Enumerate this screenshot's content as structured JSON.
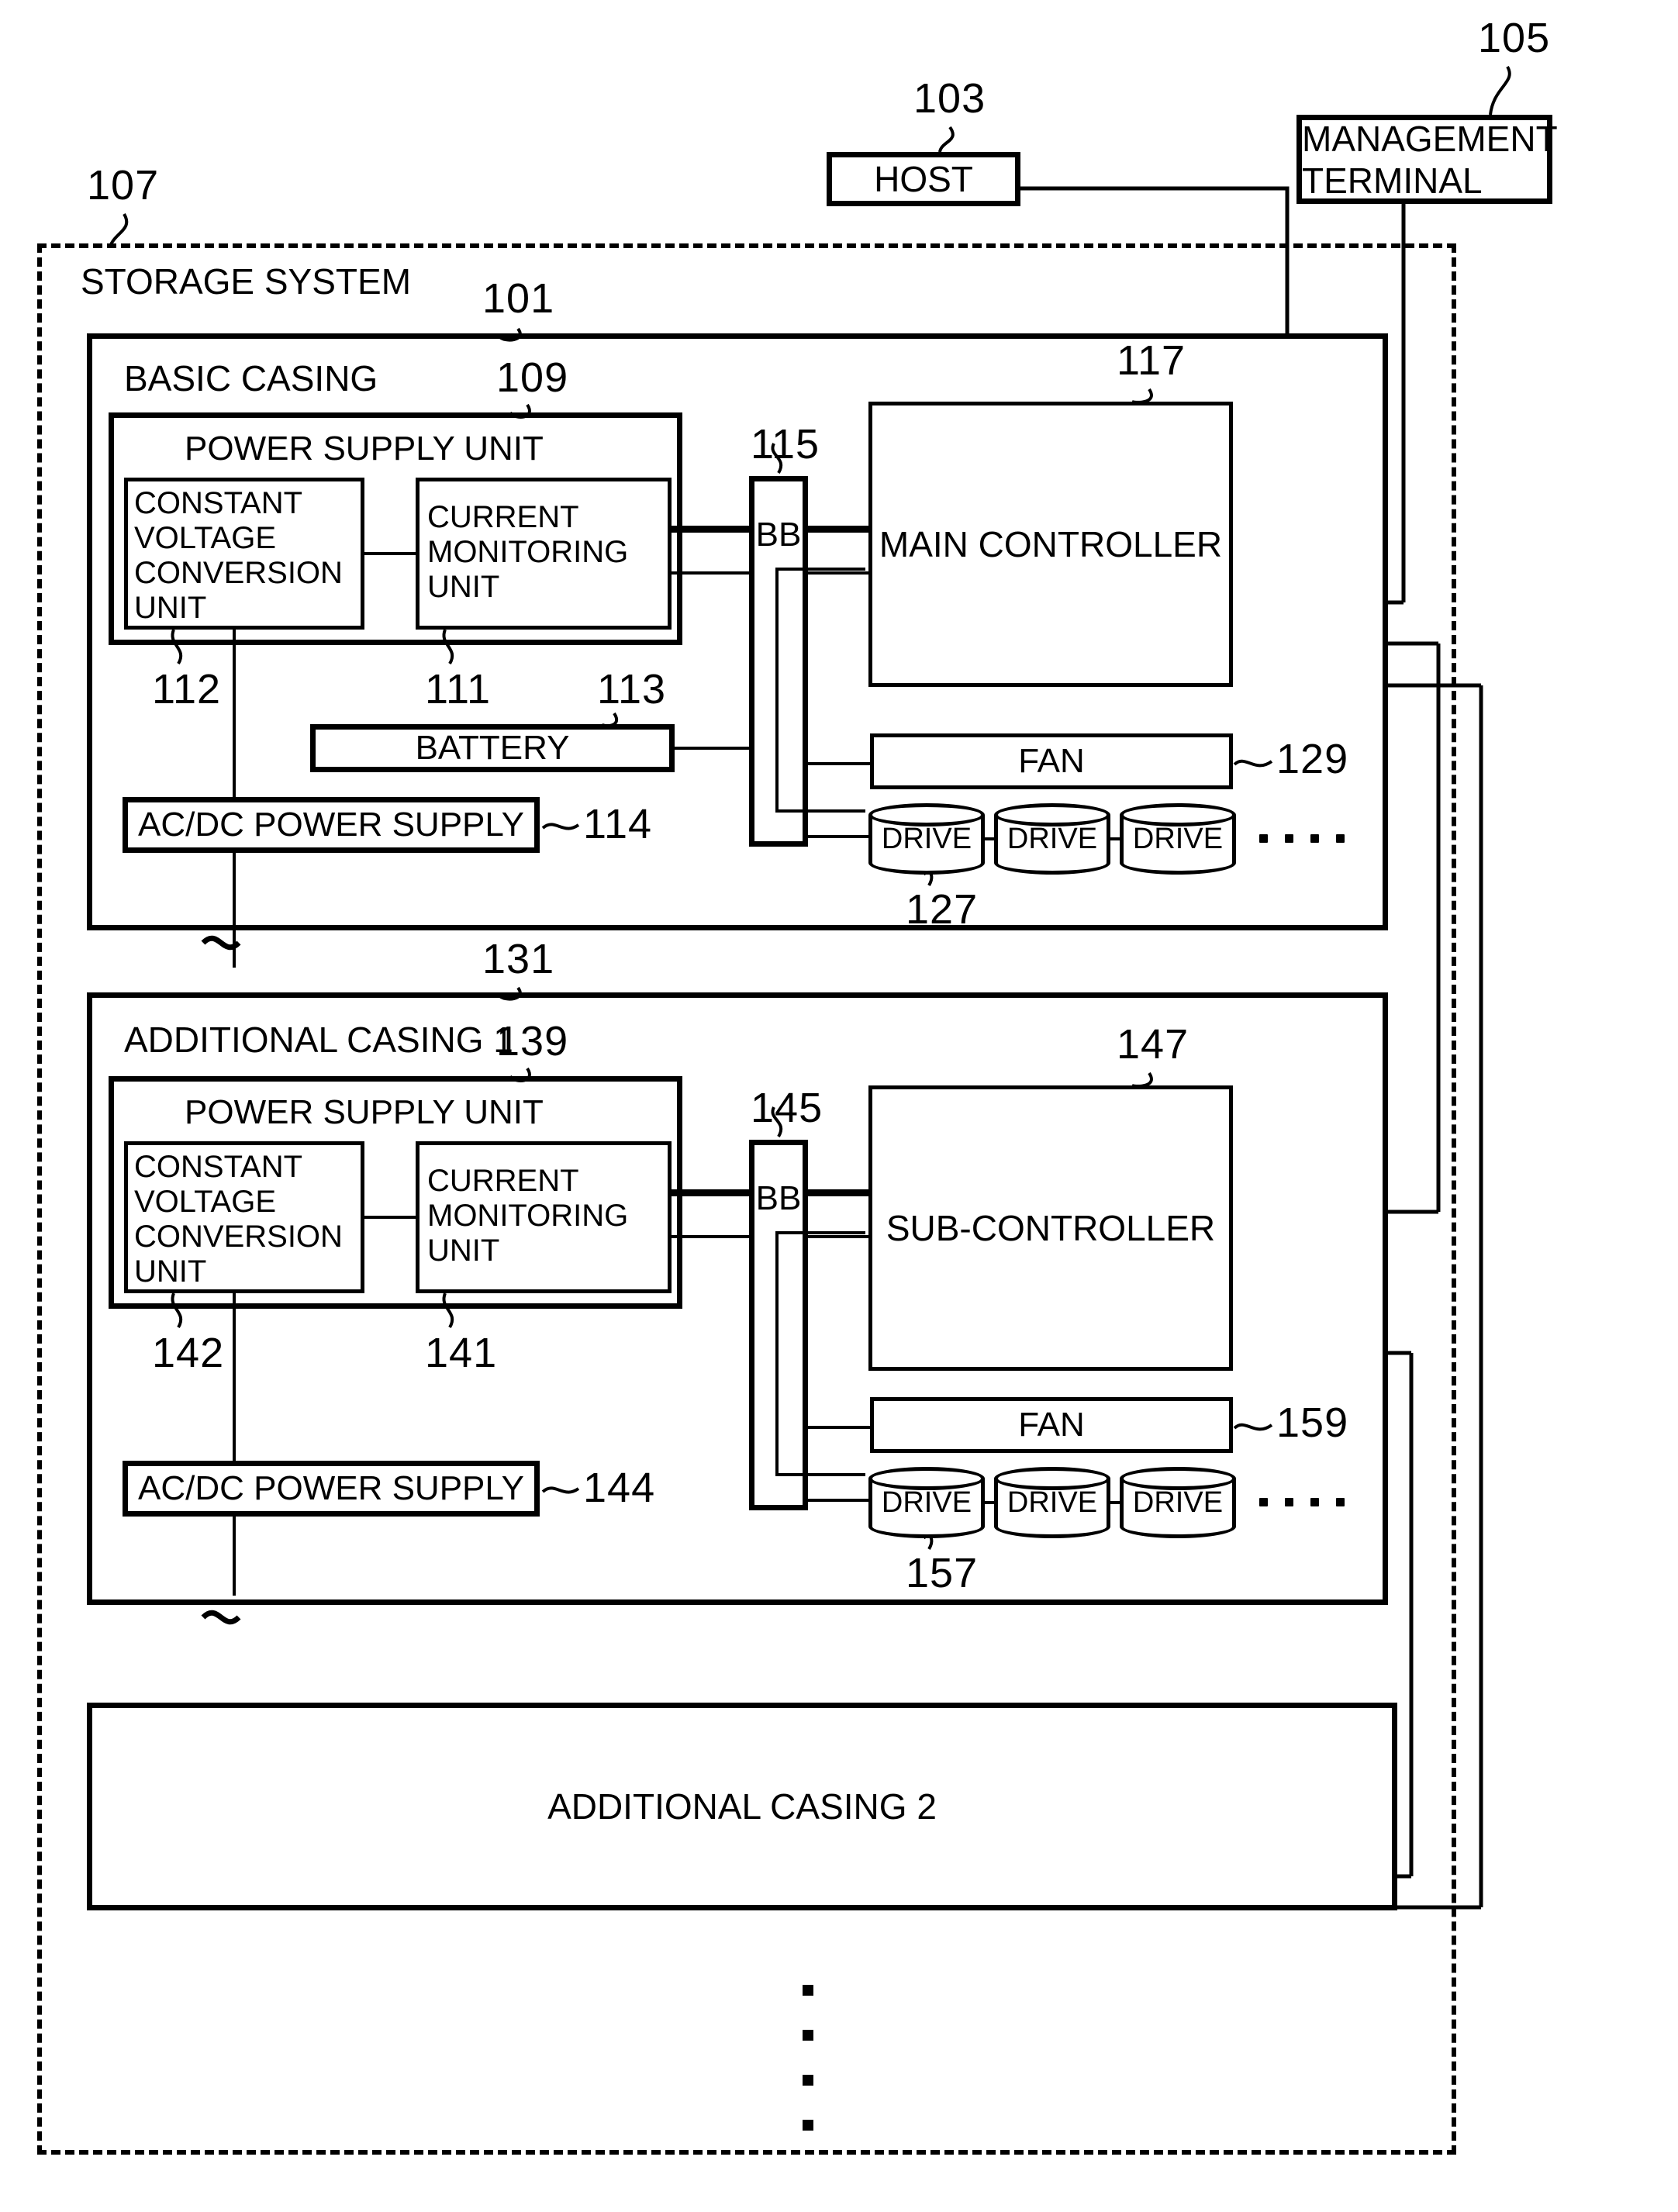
{
  "figure": {
    "kind": "patent-block-diagram",
    "title_absent": true
  },
  "external": {
    "host": {
      "label": "HOST",
      "ref": "103"
    },
    "management_terminal": {
      "label": "MANAGEMENT\nTERMINAL",
      "line1": "MANAGEMENT",
      "line2": "TERMINAL",
      "ref": "105"
    }
  },
  "storage_system": {
    "label": "STORAGE SYSTEM",
    "ref": "107",
    "basic_casing": {
      "label": "BASIC CASING",
      "ref": "101",
      "power_supply_unit": {
        "label": "POWER SUPPLY UNIT",
        "ref": "109",
        "constant_voltage_conversion_unit": {
          "label": "CONSTANT VOLTAGE CONVERSION UNIT",
          "line1": "CONSTANT",
          "line2": "VOLTAGE",
          "line3": "CONVERSION",
          "line4": "UNIT",
          "ref": "112"
        },
        "current_monitoring_unit": {
          "label": "CURRENT MONITORING UNIT",
          "line1": "CURRENT",
          "line2": "MONITORING",
          "line3": "UNIT",
          "ref": "111"
        }
      },
      "battery": {
        "label": "BATTERY",
        "ref": "113"
      },
      "ac_dc_power_supply": {
        "label": "AC/DC POWER SUPPLY",
        "ref": "114"
      },
      "backboard": {
        "label": "BB",
        "ref": "115"
      },
      "controller": {
        "label": "MAIN CONTROLLER",
        "ref": "117"
      },
      "fan": {
        "label": "FAN",
        "ref": "129"
      },
      "drives": {
        "label": "DRIVE",
        "ref": "127",
        "count_shown": 3,
        "more_indicator": "...."
      }
    },
    "additional_casing_1": {
      "label": "ADDITIONAL CASING 1",
      "ref": "131",
      "power_supply_unit": {
        "label": "POWER SUPPLY UNIT",
        "ref": "139",
        "constant_voltage_conversion_unit": {
          "label": "CONSTANT VOLTAGE CONVERSION UNIT",
          "line1": "CONSTANT",
          "line2": "VOLTAGE",
          "line3": "CONVERSION",
          "line4": "UNIT",
          "ref": "142"
        },
        "current_monitoring_unit": {
          "label": "CURRENT MONITORING UNIT",
          "line1": "CURRENT",
          "line2": "MONITORING",
          "line3": "UNIT",
          "ref": "141"
        }
      },
      "ac_dc_power_supply": {
        "label": "AC/DC POWER SUPPLY",
        "ref": "144"
      },
      "backboard": {
        "label": "BB",
        "ref": "145"
      },
      "controller": {
        "label": "SUB-CONTROLLER",
        "ref": "147"
      },
      "fan": {
        "label": "FAN",
        "ref": "159"
      },
      "drives": {
        "label": "DRIVE",
        "ref": "157",
        "count_shown": 3,
        "more_indicator": "...."
      }
    },
    "additional_casing_2": {
      "label": "ADDITIONAL CASING 2"
    },
    "continuation_indicator": "vertical-ellipsis"
  },
  "colors": {
    "ink": "#000000",
    "paper": "#ffffff"
  }
}
